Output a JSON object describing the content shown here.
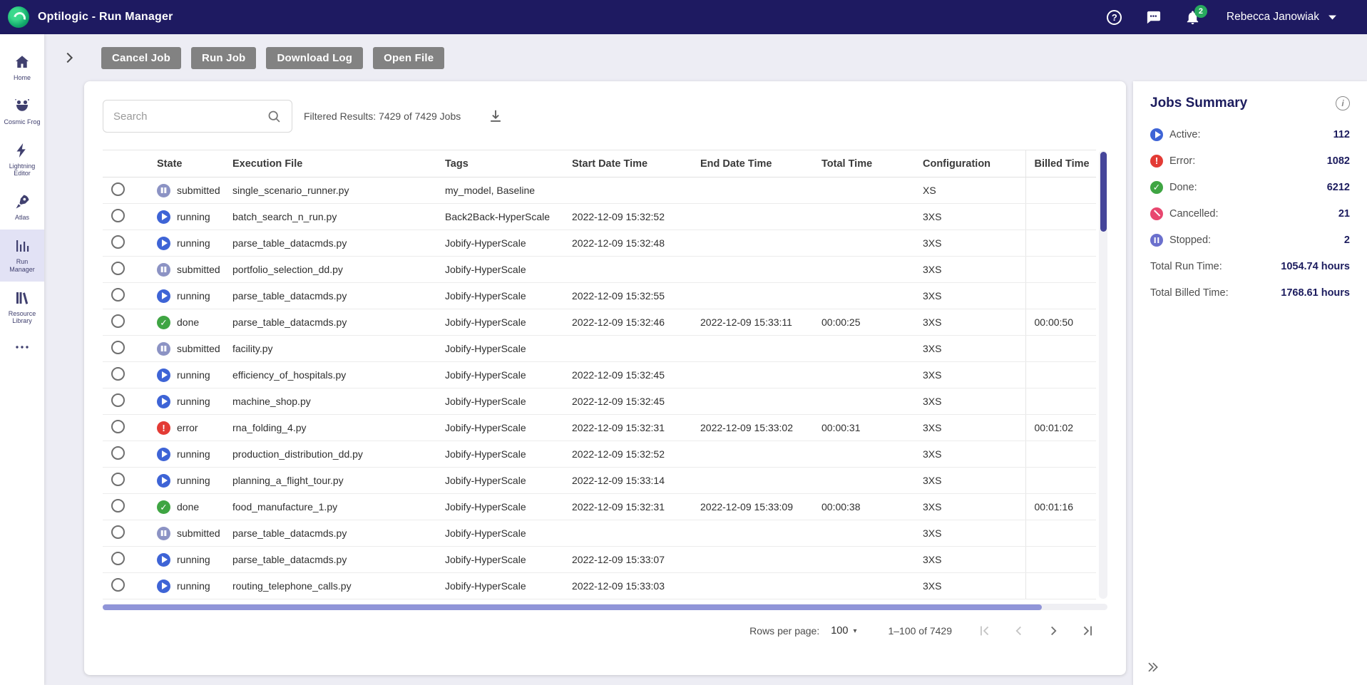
{
  "topbar": {
    "title": "Optilogic - Run Manager",
    "user_name": "Rebecca Janowiak",
    "notification_count": "2"
  },
  "icons": {
    "logo": "optilogic-swirl",
    "help": "question-mark-circle",
    "chat": "speech-bubble-dots",
    "notifications": "bell",
    "user_caret": "chevron-down",
    "search": "magnifier",
    "download": "download-arrow",
    "expand_panel": "chevron-right",
    "collapse_panel": "chevron-double-right",
    "info": "i-circle",
    "pagination": [
      "first-page",
      "previous-page",
      "next-page",
      "last-page"
    ]
  },
  "sidebar": {
    "items": [
      {
        "label": "Home",
        "icon": "home-icon",
        "selected": false
      },
      {
        "label": "Cosmic Frog",
        "icon": "frog-icon",
        "selected": false
      },
      {
        "label": "Lightning Editor",
        "icon": "lightning-icon",
        "selected": false
      },
      {
        "label": "Atlas",
        "icon": "rocket-icon",
        "selected": false
      },
      {
        "label": "Run Manager",
        "icon": "bar-chart-icon",
        "selected": true
      },
      {
        "label": "Resource Library",
        "icon": "books-icon",
        "selected": false
      }
    ],
    "more": "more-ellipsis-icon"
  },
  "toolbar": {
    "buttons": [
      "Cancel Job",
      "Run Job",
      "Download Log",
      "Open File"
    ]
  },
  "search": {
    "placeholder": "Search",
    "value": ""
  },
  "filtered_results": "Filtered Results: 7429 of 7429 Jobs",
  "table": {
    "columns": [
      "State",
      "Execution File",
      "Tags",
      "Start Date Time",
      "End Date Time",
      "Total Time",
      "Configuration",
      "Billed Time"
    ],
    "rows": [
      {
        "state_key": "submitted",
        "state_label": "submitted",
        "file": "single_scenario_runner.py",
        "tags": "my_model, Baseline",
        "start": "",
        "end": "",
        "total": "",
        "config": "XS",
        "billed": ""
      },
      {
        "state_key": "running",
        "state_label": "running",
        "file": "batch_search_n_run.py",
        "tags": "Back2Back-HyperScale",
        "start": "2022-12-09 15:32:52",
        "end": "",
        "total": "",
        "config": "3XS",
        "billed": ""
      },
      {
        "state_key": "running",
        "state_label": "running",
        "file": "parse_table_datacmds.py",
        "tags": "Jobify-HyperScale",
        "start": "2022-12-09 15:32:48",
        "end": "",
        "total": "",
        "config": "3XS",
        "billed": ""
      },
      {
        "state_key": "submitted",
        "state_label": "submitted",
        "file": "portfolio_selection_dd.py",
        "tags": "Jobify-HyperScale",
        "start": "",
        "end": "",
        "total": "",
        "config": "3XS",
        "billed": ""
      },
      {
        "state_key": "running",
        "state_label": "running",
        "file": "parse_table_datacmds.py",
        "tags": "Jobify-HyperScale",
        "start": "2022-12-09 15:32:55",
        "end": "",
        "total": "",
        "config": "3XS",
        "billed": ""
      },
      {
        "state_key": "done",
        "state_label": "done",
        "file": "parse_table_datacmds.py",
        "tags": "Jobify-HyperScale",
        "start": "2022-12-09 15:32:46",
        "end": "2022-12-09 15:33:11",
        "total": "00:00:25",
        "config": "3XS",
        "billed": "00:00:50"
      },
      {
        "state_key": "submitted",
        "state_label": "submitted",
        "file": "facility.py",
        "tags": "Jobify-HyperScale",
        "start": "",
        "end": "",
        "total": "",
        "config": "3XS",
        "billed": ""
      },
      {
        "state_key": "running",
        "state_label": "running",
        "file": "efficiency_of_hospitals.py",
        "tags": "Jobify-HyperScale",
        "start": "2022-12-09 15:32:45",
        "end": "",
        "total": "",
        "config": "3XS",
        "billed": ""
      },
      {
        "state_key": "running",
        "state_label": "running",
        "file": "machine_shop.py",
        "tags": "Jobify-HyperScale",
        "start": "2022-12-09 15:32:45",
        "end": "",
        "total": "",
        "config": "3XS",
        "billed": ""
      },
      {
        "state_key": "error",
        "state_label": "error",
        "file": "rna_folding_4.py",
        "tags": "Jobify-HyperScale",
        "start": "2022-12-09 15:32:31",
        "end": "2022-12-09 15:33:02",
        "total": "00:00:31",
        "config": "3XS",
        "billed": "00:01:02"
      },
      {
        "state_key": "running",
        "state_label": "running",
        "file": "production_distribution_dd.py",
        "tags": "Jobify-HyperScale",
        "start": "2022-12-09 15:32:52",
        "end": "",
        "total": "",
        "config": "3XS",
        "billed": ""
      },
      {
        "state_key": "running",
        "state_label": "running",
        "file": "planning_a_flight_tour.py",
        "tags": "Jobify-HyperScale",
        "start": "2022-12-09 15:33:14",
        "end": "",
        "total": "",
        "config": "3XS",
        "billed": ""
      },
      {
        "state_key": "done",
        "state_label": "done",
        "file": "food_manufacture_1.py",
        "tags": "Jobify-HyperScale",
        "start": "2022-12-09 15:32:31",
        "end": "2022-12-09 15:33:09",
        "total": "00:00:38",
        "config": "3XS",
        "billed": "00:01:16"
      },
      {
        "state_key": "submitted",
        "state_label": "submitted",
        "file": "parse_table_datacmds.py",
        "tags": "Jobify-HyperScale",
        "start": "",
        "end": "",
        "total": "",
        "config": "3XS",
        "billed": ""
      },
      {
        "state_key": "running",
        "state_label": "running",
        "file": "parse_table_datacmds.py",
        "tags": "Jobify-HyperScale",
        "start": "2022-12-09 15:33:07",
        "end": "",
        "total": "",
        "config": "3XS",
        "billed": ""
      },
      {
        "state_key": "running",
        "state_label": "running",
        "file": "routing_telephone_calls.py",
        "tags": "Jobify-HyperScale",
        "start": "2022-12-09 15:33:03",
        "end": "",
        "total": "",
        "config": "3XS",
        "billed": ""
      }
    ]
  },
  "pagination": {
    "rows_per_page_label": "Rows per page:",
    "rows_per_page_value": "100",
    "range_label": "1–100 of 7429"
  },
  "summary": {
    "title": "Jobs Summary",
    "items": [
      {
        "label": "Active:",
        "value": "112",
        "icon": "running"
      },
      {
        "label": "Error:",
        "value": "1082",
        "icon": "error"
      },
      {
        "label": "Done:",
        "value": "6212",
        "icon": "done"
      },
      {
        "label": "Cancelled:",
        "value": "21",
        "icon": "cancelled"
      },
      {
        "label": "Stopped:",
        "value": "2",
        "icon": "stopped"
      }
    ],
    "totals": [
      {
        "label": "Total Run Time:",
        "value": "1054.74 hours"
      },
      {
        "label": "Total Billed Time:",
        "value": "1768.61 hours"
      }
    ]
  },
  "colors": {
    "brand_navy": "#1e1a61",
    "accent_lavender": "#e2e2f5",
    "status_submitted": "#8c93c4",
    "status_running": "#3e64d6",
    "status_done": "#3fa543",
    "status_error": "#e33b35",
    "status_cancelled": "#e8476f",
    "status_stopped": "#6b70cd",
    "badge_green": "#27a95e"
  }
}
